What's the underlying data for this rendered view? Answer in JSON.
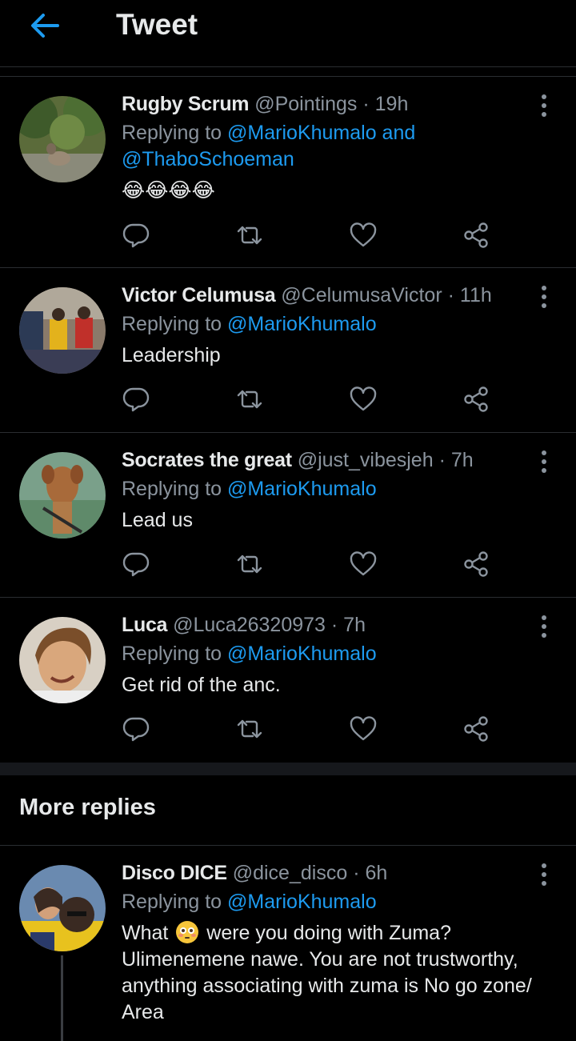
{
  "header": {
    "title": "Tweet"
  },
  "tweets": [
    {
      "name": "Rugby Scrum",
      "handle": "@Pointings",
      "time": "19h",
      "replying_prefix": "Replying to",
      "mention1": "@MarioKhumalo",
      "and_word": "and",
      "mention2": "@ThaboSchoeman",
      "body": "😂😂😂😂"
    },
    {
      "name": "Victor Celumusa",
      "handle": "@CelumusaVictor",
      "time": "11h",
      "replying_prefix": "Replying to",
      "mention1": "@MarioKhumalo",
      "body": "Leadership"
    },
    {
      "name": "Socrates the great",
      "handle": "@just_vibesjeh",
      "time": "7h",
      "replying_prefix": "Replying to",
      "mention1": "@MarioKhumalo",
      "body": "Lead us"
    },
    {
      "name": "Luca",
      "handle": "@Luca26320973",
      "time": "7h",
      "replying_prefix": "Replying to",
      "mention1": "@MarioKhumalo",
      "body": "Get rid of the anc."
    }
  ],
  "more_replies": {
    "title": "More replies",
    "tweet": {
      "name": "Disco DICE",
      "handle": "@dice_disco",
      "time": "6h",
      "replying_prefix": "Replying to",
      "mention1": "@MarioKhumalo",
      "body_part1": "What",
      "body_part2": "were you doing with Zuma?",
      "body_line2": "Ulimenemene nawe. You are not trustworthy,",
      "body_line3": "anything associating with zuma is No go zone/",
      "body_line4": "Area"
    }
  },
  "icons": {
    "back": "arrow-left-icon",
    "more": "more-vertical-icon",
    "reply": "reply-icon",
    "retweet": "retweet-icon",
    "like": "heart-icon",
    "share": "share-icon"
  },
  "colors": {
    "accent": "#1d9bf0",
    "background": "#000000",
    "muted": "#8b949e",
    "text": "#e7e9ea"
  }
}
